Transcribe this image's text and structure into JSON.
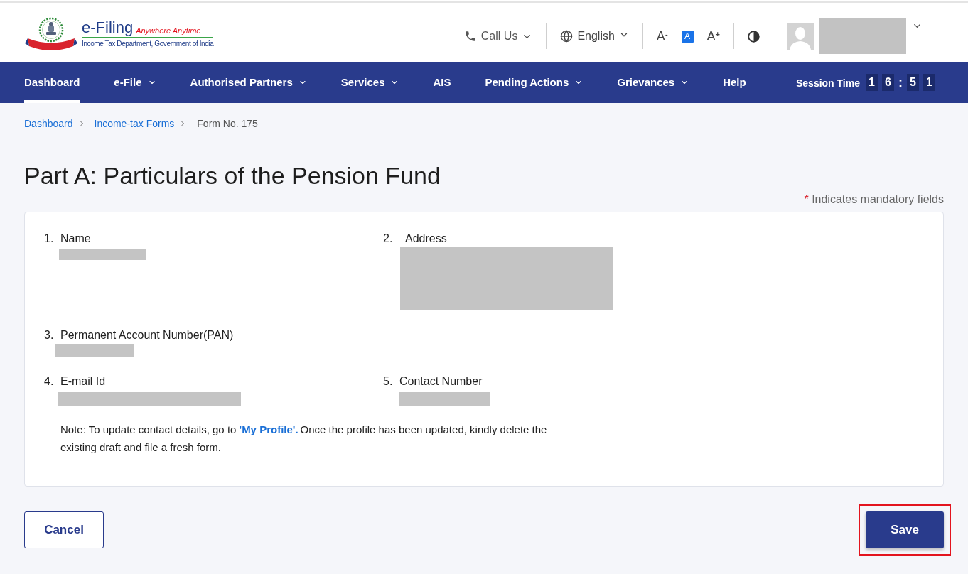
{
  "header": {
    "logo": {
      "title": "e-Filing",
      "tagline": "Anywhere Anytime",
      "subtitle": "Income Tax Department, Government of India"
    },
    "call_us": {
      "label": "Call Us"
    },
    "language": {
      "label": "English"
    },
    "font_size_controls": [
      {
        "label": "A$^{-}$",
        "selected": false
      },
      {
        "label": "A",
        "selected": true
      },
      {
        "label": "A$^{+}$",
        "selected": false
      }
    ],
    "profile": {
      "name_redacted": true
    }
  },
  "nav": {
    "items": [
      {
        "label": "Dashboard",
        "selected": true,
        "dropdown": false
      },
      {
        "label": "e-File",
        "selected": false,
        "dropdown": true
      },
      {
        "label": "Authorised Partners",
        "selected": false,
        "dropdown": true
      },
      {
        "label": "Services",
        "selected": false,
        "dropdown": true
      },
      {
        "label": "AIS",
        "selected": false,
        "dropdown": false
      },
      {
        "label": "Pending Actions",
        "selected": false,
        "dropdown": true
      },
      {
        "label": "Grievances",
        "selected": false,
        "dropdown": true
      },
      {
        "label": "Help",
        "selected": false,
        "dropdown": false
      }
    ],
    "session_time": {
      "label": "Session Time",
      "hours": [
        "1",
        "6"
      ],
      "separator": ":",
      "minutes": [
        "5",
        "1"
      ]
    }
  },
  "breadcrumb": [
    {
      "label": "Dashboard",
      "current": false
    },
    {
      "label": "Income-tax Forms",
      "current": false
    },
    {
      "label": "Form No. 175",
      "current": true
    }
  ],
  "page_title": "Part A: Particulars of the Pension Fund",
  "mandatory_note": {
    "mark": "*",
    "text": "Indicates mandatory fields"
  },
  "form": {
    "rows": [
      {
        "fields": [
          {
            "number": "1.",
            "label": "Name",
            "redacted": true
          },
          {
            "number": "2.",
            "label": "Address",
            "redacted": true
          }
        ]
      },
      {
        "fields": [
          {
            "number": "3.",
            "label": "Permanent Account Number(PAN)",
            "redacted": true
          }
        ]
      },
      {
        "fields": [
          {
            "number": "4.",
            "label": "E-mail Id",
            "redacted": true
          },
          {
            "number": "5.",
            "label": "Contact Number",
            "redacted": true
          }
        ]
      }
    ],
    "note": {
      "before": "Note: To update contact details, go to ",
      "link": "'My Profile'.",
      "after": "Once the profile has been updated, kindly delete the existing draft and file a fresh form."
    }
  },
  "buttons": [
    {
      "label": "Cancel",
      "kind": "secondary",
      "highlighted": false
    },
    {
      "label": "Save",
      "kind": "primary",
      "highlighted": true
    }
  ]
}
